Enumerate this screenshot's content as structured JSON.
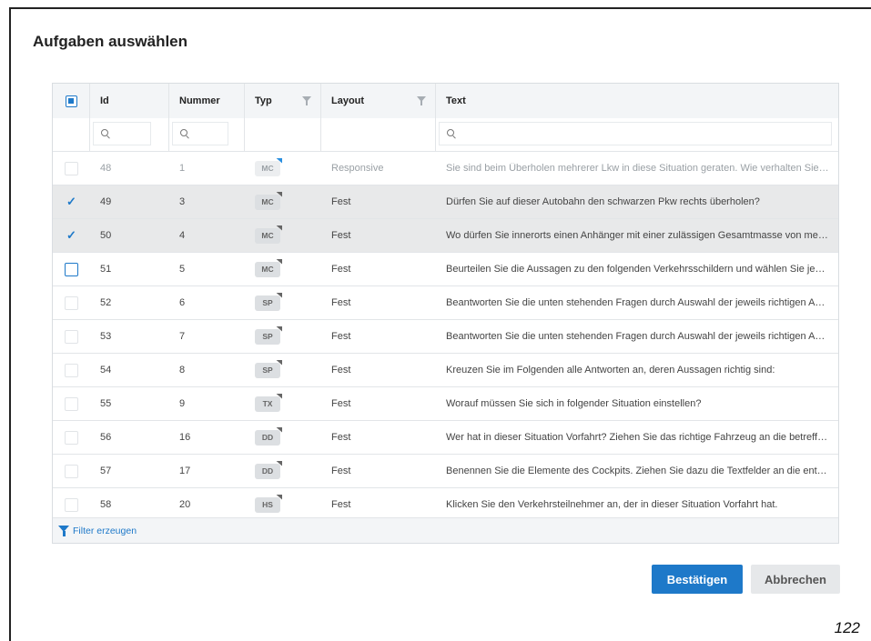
{
  "dialog": {
    "title": "Aufgaben auswählen"
  },
  "columns": {
    "id": "Id",
    "nummer": "Nummer",
    "typ": "Typ",
    "layout": "Layout",
    "text": "Text"
  },
  "rows": [
    {
      "id": "48",
      "nummer": "1",
      "typ": "MC",
      "layout": "Responsive",
      "text": "Sie sind beim Überholen mehrerer Lkw in diese Situation geraten. Wie verhalten Sie sic...",
      "state": "disabled"
    },
    {
      "id": "49",
      "nummer": "3",
      "typ": "MC",
      "layout": "Fest",
      "text": "Dürfen Sie auf dieser Autobahn den schwarzen Pkw rechts überholen?",
      "state": "checked"
    },
    {
      "id": "50",
      "nummer": "4",
      "typ": "MC",
      "layout": "Fest",
      "text": "Wo dürfen Sie innerorts einen Anhänger mit einer zulässigen Gesamtmasse von mehr a...",
      "state": "checked"
    },
    {
      "id": "51",
      "nummer": "5",
      "typ": "MC",
      "layout": "Fest",
      "text": "Beurteilen Sie die Aussagen zu den folgenden Verkehrsschildern und wählen Sie jeweils ...",
      "state": "focused"
    },
    {
      "id": "52",
      "nummer": "6",
      "typ": "SP",
      "layout": "Fest",
      "text": "Beantworten Sie die unten stehenden Fragen durch Auswahl der jeweils richtigen Antw...",
      "state": "unchecked"
    },
    {
      "id": "53",
      "nummer": "7",
      "typ": "SP",
      "layout": "Fest",
      "text": "Beantworten Sie die unten stehenden Fragen durch Auswahl der jeweils richtigen Antw...",
      "state": "unchecked"
    },
    {
      "id": "54",
      "nummer": "8",
      "typ": "SP",
      "layout": "Fest",
      "text": "Kreuzen Sie im Folgenden alle Antworten an, deren Aussagen richtig sind:",
      "state": "unchecked"
    },
    {
      "id": "55",
      "nummer": "9",
      "typ": "TX",
      "layout": "Fest",
      "text": "Worauf müssen Sie sich in folgender Situation einstellen?",
      "state": "unchecked"
    },
    {
      "id": "56",
      "nummer": "16",
      "typ": "DD",
      "layout": "Fest",
      "text": "Wer hat in dieser Situation Vorfahrt? Ziehen Sie das richtige Fahrzeug an die betreffend...",
      "state": "unchecked"
    },
    {
      "id": "57",
      "nummer": "17",
      "typ": "DD",
      "layout": "Fest",
      "text": "Benennen Sie die Elemente des Cockpits.  Ziehen Sie dazu die Textfelder an die entspre...",
      "state": "unchecked"
    },
    {
      "id": "58",
      "nummer": "20",
      "typ": "HS",
      "layout": "Fest",
      "text": "Klicken Sie den Verkehrsteilnehmer an, der in dieser Situation Vorfahrt hat.",
      "state": "unchecked"
    }
  ],
  "footer": {
    "filter_link": "Filter erzeugen"
  },
  "buttons": {
    "confirm": "Bestätigen",
    "cancel": "Abbrechen"
  },
  "page_number": "122",
  "colors": {
    "accent": "#1e79c9",
    "selected_row": "#e8e9ea"
  }
}
